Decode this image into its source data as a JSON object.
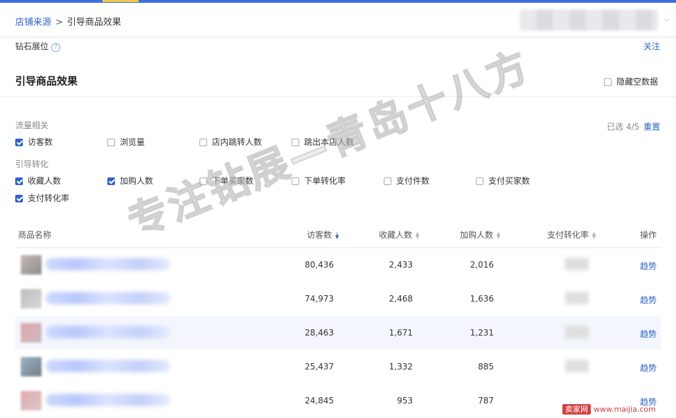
{
  "breadcrumb": {
    "parent": "店铺来源",
    "separator": ">",
    "current": "引导商品效果"
  },
  "source_label": "钻石展位",
  "follow_label": "关注",
  "section_title": "引导商品效果",
  "hide_empty_label": "隐藏空数据",
  "selected_info": "已选 4/5",
  "reset_label": "重置",
  "groups": [
    {
      "label": "流量相关",
      "options": [
        {
          "label": "访客数",
          "checked": true
        },
        {
          "label": "浏览量",
          "checked": false
        },
        {
          "label": "店内跳转人数",
          "checked": false
        },
        {
          "label": "跳出本店人数",
          "checked": false
        }
      ]
    },
    {
      "label": "引导转化",
      "options": [
        {
          "label": "收藏人数",
          "checked": true
        },
        {
          "label": "加购人数",
          "checked": true
        },
        {
          "label": "下单买家数",
          "checked": false
        },
        {
          "label": "下单转化率",
          "checked": false
        },
        {
          "label": "支付件数",
          "checked": false
        },
        {
          "label": "支付买家数",
          "checked": false
        },
        {
          "label": "支付转化率",
          "checked": true
        }
      ]
    }
  ],
  "table": {
    "columns": [
      "商品名称",
      "访客数",
      "收藏人数",
      "加购人数",
      "支付转化率",
      "操作"
    ],
    "sort_active": "访客数",
    "rows": [
      {
        "visitors": "80,436",
        "favorites": "2,433",
        "add_cart": "2,016",
        "action": "趋势"
      },
      {
        "visitors": "74,973",
        "favorites": "2,468",
        "add_cart": "1,636",
        "action": "趋势"
      },
      {
        "visitors": "28,463",
        "favorites": "1,671",
        "add_cart": "1,231",
        "action": "趋势"
      },
      {
        "visitors": "25,437",
        "favorites": "1,332",
        "add_cart": "885",
        "action": "趋势"
      },
      {
        "visitors": "24,845",
        "favorites": "953",
        "add_cart": "787",
        "action": "趋势"
      }
    ]
  },
  "watermark": "专注钻展—青岛十八方",
  "site_mark": {
    "badge": "卖家网",
    "url": "www.maijia.com"
  },
  "colors": {
    "accent": "#2e63c9",
    "topbar": "#3d6fe0",
    "tab_marker": "#f2c94c",
    "row_highlight": "#f3f6fc"
  }
}
